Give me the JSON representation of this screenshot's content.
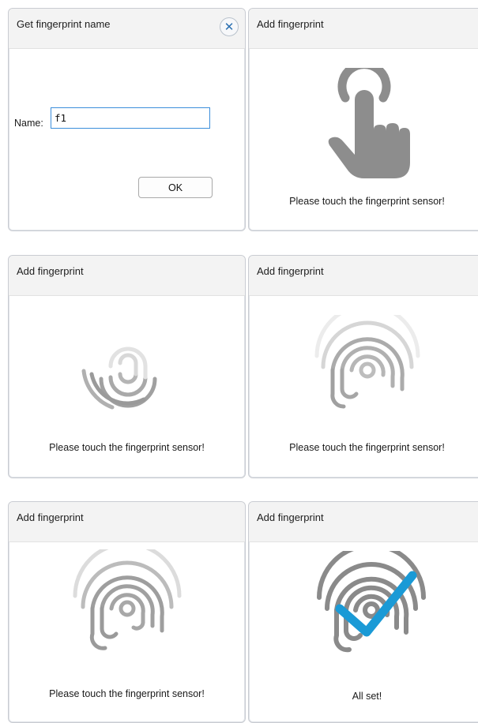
{
  "name_dialog": {
    "title": "Get fingerprint name",
    "close_icon": "close-icon",
    "name_label": "Name:",
    "name_value": "f1",
    "ok_label": "OK"
  },
  "steps": [
    {
      "title": "Add fingerprint",
      "message": "Please touch the fingerprint sensor!",
      "icon": "touch-hand-icon"
    },
    {
      "title": "Add fingerprint",
      "message": "Please touch the fingerprint sensor!",
      "icon": "fingerprint-partial-icon"
    },
    {
      "title": "Add fingerprint",
      "message": "Please touch the fingerprint sensor!",
      "icon": "fingerprint-progress-icon"
    },
    {
      "title": "Add fingerprint",
      "message": "Please touch the fingerprint sensor!",
      "icon": "fingerprint-progress-icon"
    },
    {
      "title": "Add fingerprint",
      "message": "All set!",
      "icon": "fingerprint-check-icon"
    }
  ],
  "colors": {
    "accent": "#1a9ad6",
    "fingerprint": "#8a8a8a",
    "hand": "#8d8d8d"
  }
}
